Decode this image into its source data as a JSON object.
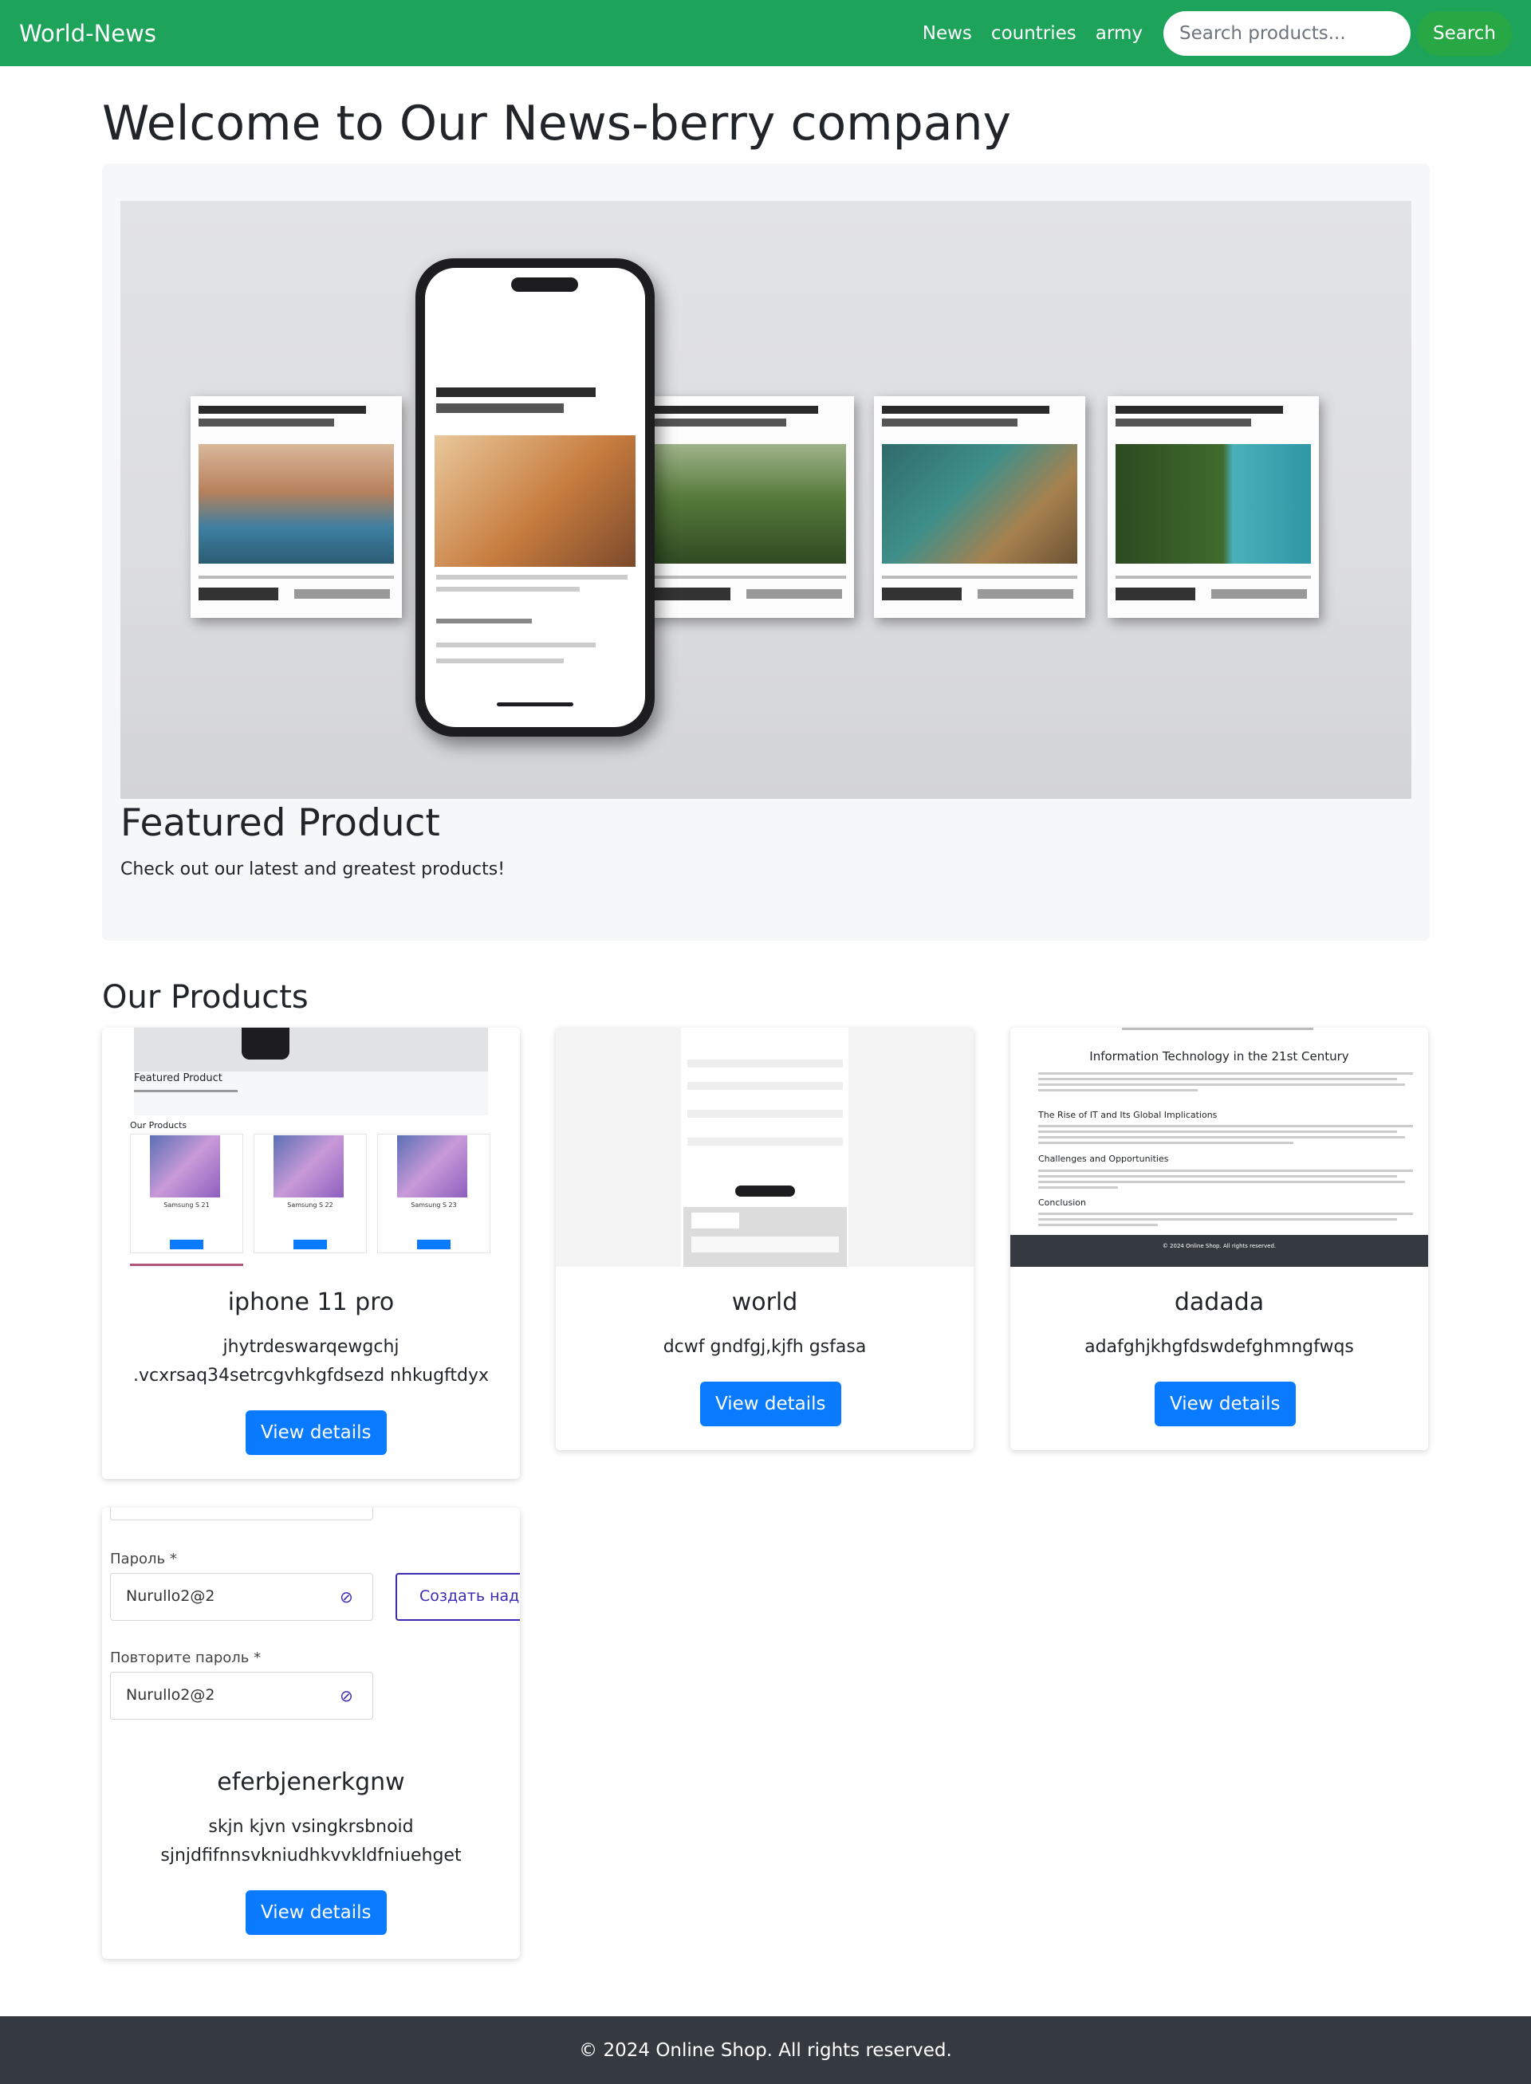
{
  "navbar": {
    "brand": "World-News",
    "links": [
      "News",
      "countries",
      "army"
    ],
    "search_placeholder": "Search products...",
    "search_button": "Search",
    "color": "#1ea35b"
  },
  "header": {
    "title": "Welcome to Our News-berry company"
  },
  "hero": {
    "heading": "Featured Product",
    "text": "Check out our latest and greatest products!"
  },
  "products": {
    "title": "Our Products",
    "button_label": "View details",
    "items": [
      {
        "title": "iphone 11 pro",
        "description": "jhytrdeswarqewgchj .vcxrsaq34setrcgvhkgfdsezd nhkugftdyx"
      },
      {
        "title": "world",
        "description": "dcwf gndfgj,kjfh gsfasa"
      },
      {
        "title": "dadada",
        "description": "adafghjkhgfdswdefghmngfwqs"
      },
      {
        "title": "eferbjenerkgnw",
        "description": "skjn kjvn vsingkrsbnoid sjnjdfifnnsvkniudhkvvkldfniuehget"
      }
    ]
  },
  "thumbnails": {
    "card1": {
      "featured": "Featured Product",
      "section": "Our Products",
      "items": [
        "Samsung S 21",
        "Samsung S 22",
        "Samsung S 23"
      ]
    },
    "card3": {
      "headings": [
        "Information Technology in the 21st Century",
        "The Rise of IT and Its Global Implications",
        "Challenges and Opportunities",
        "Conclusion"
      ],
      "footer": "© 2024 Online Shop. All rights reserved."
    },
    "card4": {
      "password_label": "Пароль *",
      "password_value": "Nurullo2@2",
      "repeat_label": "Повторите пароль *",
      "repeat_value": "Nurullo2@2",
      "create_button": "Создать наде"
    }
  },
  "footer": {
    "text": "© 2024 Online Shop. All rights reserved."
  },
  "colors": {
    "primary": "#0a7bff",
    "success": "#28a745",
    "footer": "#343a40"
  }
}
